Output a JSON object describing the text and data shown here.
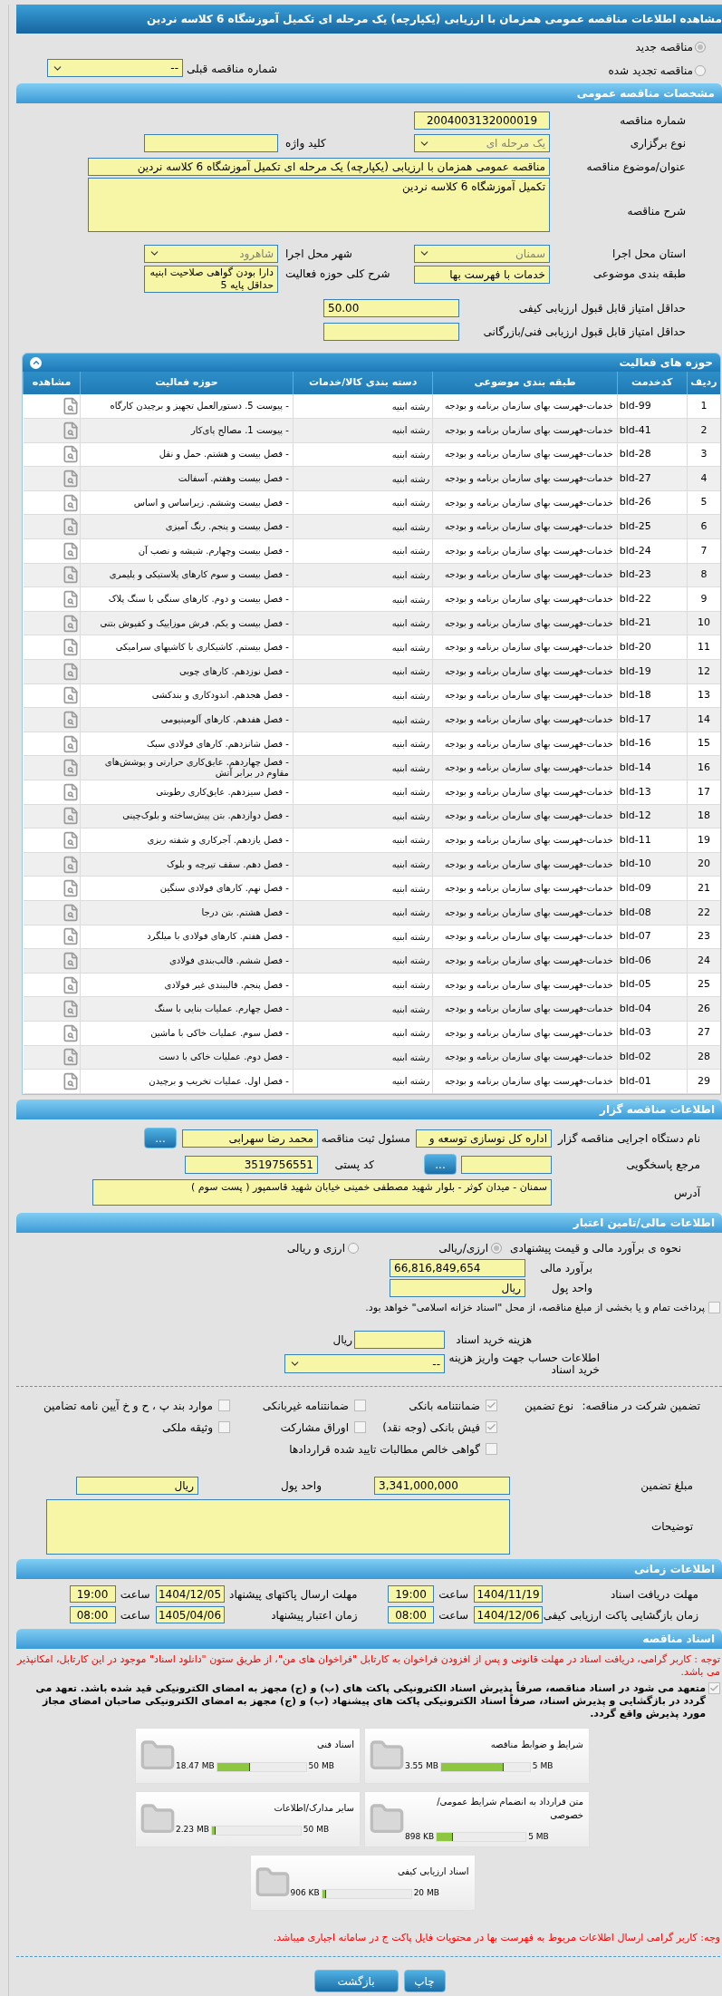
{
  "title": "مشاهده اطلاعات مناقصه عمومی همزمان با ارزیابی (یکپارچه) یک مرحله ای تکمیل آموزشگاه 6 کلاسه نردین",
  "tender_kind": [
    {
      "label": "مناقصه جدید",
      "selected": true
    },
    {
      "label": "مناقصه تجدید شده",
      "selected": false
    }
  ],
  "previous_tender": {
    "label": "شماره مناقصه قبلی",
    "value": "--"
  },
  "general": {
    "header": "مشخصات مناقصه عمومی",
    "tender_number": {
      "label": "شماره مناقصه",
      "value": "2004003132000019"
    },
    "holding_type": {
      "label": "نوع برگزاری",
      "value": "یک مرحله ای"
    },
    "keyword": {
      "label": "کلید واژه"
    },
    "subject": {
      "label": "عنوان/موضوع مناقصه",
      "value": "مناقصه عمومی همزمان با ارزیابی (یکپارچه) یک مرحله ای تکمیل آموزشگاه 6 کلاسه نردین"
    },
    "description": {
      "label": "شرح مناقصه",
      "value": "تکمیل آموزشگاه 6 کلاسه نردین"
    },
    "province": {
      "label": "استان محل اجرا",
      "value": "سمنان"
    },
    "city": {
      "label": "شهر محل اجرا",
      "value": "شاهرود"
    },
    "category": {
      "label": "طبقه بندی موضوعی",
      "value": "خدمات با فهرست بها"
    },
    "scope": {
      "label": "شرح کلی حوزه فعالیت",
      "value": "دارا بودن گواهی صلاحیت ابنیه حداقل پایه 5"
    },
    "min_quality": {
      "label": "حداقل امتیاز قابل قبول ارزیابی کیفی",
      "value": "50.00"
    },
    "min_technical": {
      "label": "حداقل امتیاز قابل قبول ارزیابی فنی/بازرگانی"
    }
  },
  "activities": {
    "header": "حوزه های فعالیت",
    "columns": [
      "ردیف",
      "کدخدمت",
      "طبقه بندی موضوعی",
      "دسته بندی کالا/خدمات",
      "حوزه فعالیت",
      "مشاهده"
    ],
    "rows": [
      {
        "row": "1",
        "code": "bld-99",
        "category": "خدمات-فهرست بهای سازمان برنامه و بودجه",
        "group": "رشته ابنیه",
        "activity": "- پیوست 5. دستورالعمل تجهیز و برچیدن کارگاه"
      },
      {
        "row": "2",
        "code": "bld-41",
        "category": "خدمات-فهرست بهای سازمان برنامه و بودجه",
        "group": "رشته ابنیه",
        "activity": "- پیوست 1. مصالح پای‌کار"
      },
      {
        "row": "3",
        "code": "bld-28",
        "category": "خدمات-فهرست بهای سازمان برنامه و بودجه",
        "group": "رشته ابنیه",
        "activity": "- فصل بیست و هشتم. حمل و نقل"
      },
      {
        "row": "4",
        "code": "bld-27",
        "category": "خدمات-فهرست بهای سازمان برنامه و بودجه",
        "group": "رشته ابنیه",
        "activity": "- فصل بیست وهفتم. آسفالت"
      },
      {
        "row": "5",
        "code": "bld-26",
        "category": "خدمات-فهرست بهای سازمان برنامه و بودجه",
        "group": "رشته ابنیه",
        "activity": "- فصل بیست وششم. زیراساس و اساس"
      },
      {
        "row": "6",
        "code": "bld-25",
        "category": "خدمات-فهرست بهای سازمان برنامه و بودجه",
        "group": "رشته ابنیه",
        "activity": "- فصل بیست و پنجم. رنگ آمیزی"
      },
      {
        "row": "7",
        "code": "bld-24",
        "category": "خدمات-فهرست بهای سازمان برنامه و بودجه",
        "group": "رشته ابنیه",
        "activity": "- فصل بیست وچهارم. شیشه و نصب آن"
      },
      {
        "row": "8",
        "code": "bld-23",
        "category": "خدمات-فهرست بهای سازمان برنامه و بودجه",
        "group": "رشته ابنیه",
        "activity": "- فصل بیست و سوم کارهای پلاستیکی و پلیمری"
      },
      {
        "row": "9",
        "code": "bld-22",
        "category": "خدمات-فهرست بهای سازمان برنامه و بودجه",
        "group": "رشته ابنیه",
        "activity": "- فصل بیست و دوم. کارهای سنگی با سنگ پلاک"
      },
      {
        "row": "10",
        "code": "bld-21",
        "category": "خدمات-فهرست بهای سازمان برنامه و بودجه",
        "group": "رشته ابنیه",
        "activity": "- فصل بیست و یکم. فرش موزاییک و کفپوش بتنی"
      },
      {
        "row": "11",
        "code": "bld-20",
        "category": "خدمات-فهرست بهای سازمان برنامه و بودجه",
        "group": "رشته ابنیه",
        "activity": "- فصل بیستم. کاشیکاری با کاشیهای سرامیکی"
      },
      {
        "row": "12",
        "code": "bld-19",
        "category": "خدمات-فهرست بهای سازمان برنامه و بودجه",
        "group": "رشته ابنیه",
        "activity": "- فصل نوزدهم. کارهای چوبی"
      },
      {
        "row": "13",
        "code": "bld-18",
        "category": "خدمات-فهرست بهای سازمان برنامه و بودجه",
        "group": "رشته ابنیه",
        "activity": "- فصل هجدهم. اندودکاری و بندکشی"
      },
      {
        "row": "14",
        "code": "bld-17",
        "category": "خدمات-فهرست بهای سازمان برنامه و بودجه",
        "group": "رشته ابنیه",
        "activity": "- فصل هفدهم. کارهای آلومینیومی"
      },
      {
        "row": "15",
        "code": "bld-16",
        "category": "خدمات-فهرست بهای سازمان برنامه و بودجه",
        "group": "رشته ابنیه",
        "activity": "- فصل شانزدهم. کارهای فولادی سبک"
      },
      {
        "row": "16",
        "code": "bld-14",
        "category": "خدمات-فهرست بهای سازمان برنامه و بودجه",
        "group": "رشته ابنیه",
        "activity": "- فصل چهاردهم. عایق‌کاری حرارتی و پوشش‌های مقاوم در برابر آتش"
      },
      {
        "row": "17",
        "code": "bld-13",
        "category": "خدمات-فهرست بهای سازمان برنامه و بودجه",
        "group": "رشته ابنیه",
        "activity": "- فصل سیزدهم. عایق‌کاری رطوبتی"
      },
      {
        "row": "18",
        "code": "bld-12",
        "category": "خدمات-فهرست بهای سازمان برنامه و بودجه",
        "group": "رشته ابنیه",
        "activity": "- فصل دوازدهم. بتن پیش‌ساخته و بلوک‌چینی"
      },
      {
        "row": "19",
        "code": "bld-11",
        "category": "خدمات-فهرست بهای سازمان برنامه و بودجه",
        "group": "رشته ابنیه",
        "activity": "- فصل یازدهم. آجرکاری و شفته ریزی"
      },
      {
        "row": "20",
        "code": "bld-10",
        "category": "خدمات-فهرست بهای سازمان برنامه و بودجه",
        "group": "رشته ابنیه",
        "activity": "- فصل دهم. سقف تیرچه و بلوک"
      },
      {
        "row": "21",
        "code": "bld-09",
        "category": "خدمات-فهرست بهای سازمان برنامه و بودجه",
        "group": "رشته ابنیه",
        "activity": "- فصل نهم. کارهای فولادی سنگین"
      },
      {
        "row": "22",
        "code": "bld-08",
        "category": "خدمات-فهرست بهای سازمان برنامه و بودجه",
        "group": "رشته ابنیه",
        "activity": "- فصل هشتم. بتن درجا"
      },
      {
        "row": "23",
        "code": "bld-07",
        "category": "خدمات-فهرست بهای سازمان برنامه و بودجه",
        "group": "رشته ابنیه",
        "activity": "- فصل هفتم. کارهای فولادی با میلگرد"
      },
      {
        "row": "24",
        "code": "bld-06",
        "category": "خدمات-فهرست بهای سازمان برنامه و بودجه",
        "group": "رشته ابنیه",
        "activity": "- فصل ششم. قالب‌بندی فولادی"
      },
      {
        "row": "25",
        "code": "bld-05",
        "category": "خدمات-فهرست بهای سازمان برنامه و بودجه",
        "group": "رشته ابنیه",
        "activity": "- فصل پنجم. قالببندی غیر فولادی"
      },
      {
        "row": "26",
        "code": "bld-04",
        "category": "خدمات-فهرست بهای سازمان برنامه و بودجه",
        "group": "رشته ابنیه",
        "activity": "- فصل چهارم. عملیات بنایی با سنگ"
      },
      {
        "row": "27",
        "code": "bld-03",
        "category": "خدمات-فهرست بهای سازمان برنامه و بودجه",
        "group": "رشته ابنیه",
        "activity": "- فصل سوم. عملیات خاکی با ماشین"
      },
      {
        "row": "28",
        "code": "bld-02",
        "category": "خدمات-فهرست بهای سازمان برنامه و بودجه",
        "group": "رشته ابنیه",
        "activity": "- فصل دوم. عملیات خاکی با دست"
      },
      {
        "row": "29",
        "code": "bld-01",
        "category": "خدمات-فهرست بهای سازمان برنامه و بودجه",
        "group": "رشته ابنیه",
        "activity": "- فصل اول. عملیات تخریب و برچیدن"
      }
    ]
  },
  "contractor": {
    "header": "اطلاعات مناقصه گزار",
    "organization": {
      "label": "نام دستگاه اجرایی مناقصه گزار",
      "value": "اداره کل نوسازی  توسعه و"
    },
    "registrar": {
      "label": "مسئول ثبت مناقصه",
      "value": "محمد رضا  سهرابی",
      "button": "..."
    },
    "reference": {
      "label": "مرجع پاسخگویی",
      "button": "..."
    },
    "postal_code": {
      "label": "کد پستی",
      "value": "3519756551"
    },
    "address": {
      "label": "آدرس",
      "value": "سمنان - میدان کوثر - بلوار شهید مصطفی خمینی خیابان شهید قاسمپور ( پست سوم )"
    }
  },
  "financial": {
    "header": "اطلاعات مالی/تامین اعتبار",
    "estimate_method": {
      "label": "نحوه ی برآورد مالی و قیمت پیشنهادی",
      "options": [
        {
          "label": "ارزی/ریالی",
          "selected": true
        },
        {
          "label": "ارزی و ریالی",
          "selected": false
        }
      ]
    },
    "estimate": {
      "label": "برآورد مالی",
      "value": "66,816,849,654"
    },
    "currency": {
      "label": "واحد پول",
      "value": "ریال"
    },
    "treasury": {
      "label": "پرداخت تمام و یا بخشی از مبلغ مناقصه، از محل \"اسناد خزانه اسلامی\" خواهد بود.",
      "checked": false
    },
    "document_fee": {
      "label": "هزینه خرید اسناد",
      "unit": "ریال"
    },
    "account": {
      "label": "اطلاعات حساب جهت واریز هزینه خرید اسناد",
      "value": "--"
    },
    "guarantee": {
      "label": "تضمین شرکت در مناقصه:",
      "type_label": "نوع تضمین",
      "options": [
        {
          "label": "ضمانتنامه بانکی",
          "checked": true
        },
        {
          "label": "ضمانتنامه غیربانکی",
          "checked": false
        },
        {
          "label": "موارد بند پ ، ح و خ آیین نامه تضامین",
          "checked": false
        },
        {
          "label": "فیش بانکی (وجه نقد)",
          "checked": true
        },
        {
          "label": "اوراق مشارکت",
          "checked": false
        },
        {
          "label": "وثیقه ملکی",
          "checked": false
        },
        {
          "label": "گواهی خالص مطالبات تایید شده قراردادها",
          "checked": false
        }
      ]
    },
    "guarantee_amount": {
      "label": "مبلغ تضمین",
      "value": "3,341,000,000"
    },
    "guarantee_currency": {
      "label": "واحد پول",
      "value": "ریال"
    },
    "notes": {
      "label": "توضیحات"
    }
  },
  "timing": {
    "header": "اطلاعات زمانی",
    "items": [
      {
        "label": "مهلت دریافت اسناد",
        "date": "1404/11/19",
        "time_label": "ساعت",
        "time": "19:00"
      },
      {
        "label": "مهلت ارسال پاکتهای پیشنهاد",
        "date": "1404/12/05",
        "time_label": "ساعت",
        "time": "19:00"
      },
      {
        "label": "زمان بازگشایی پاکت ارزیابی کیفی",
        "date": "1404/12/06",
        "time_label": "ساعت",
        "time": "08:00"
      },
      {
        "label": "زمان اعتبار پیشنهاد",
        "date": "1405/04/06",
        "time_label": "ساعت",
        "time": "08:00"
      }
    ]
  },
  "documents": {
    "header": "اسناد مناقصه",
    "notice": "توجه : کاربر گرامی، دریافت اسناد در مهلت قانونی و پس از افزودن فراخوان به کارتابل \"فراخوان های من\"، از طریق ستون \"دانلود اسناد\" موجود در این کارتابل، امکانپذیر می باشد.",
    "commitment": {
      "text": "متعهد می شود در اسناد مناقصه، صرفاً پذیرش اسناد الکترونیکی پاکت های (ب) و (ج) مجهز به امضای الکترونیکی قید شده باشد. تعهد می گردد در بازگشایی و پذیرش اسناد، صرفاً اسناد الکترونیکی پاکت های پیشنهاد (ب) و (ج) مجهز به امضای الکترونیکی صاحبان امضای مجاز مورد پذیرش واقع گردد.",
      "checked": true
    },
    "files": [
      {
        "name": "شرایط و ضوابط مناقصه",
        "size": "3.55 MB",
        "limit": "5 MB",
        "level": 0.71
      },
      {
        "name": "اسناد فنی",
        "size": "18.47 MB",
        "limit": "50 MB",
        "level": 0.37
      },
      {
        "name": "متن قرارداد به انضمام شرایط عمومی/خصوصی",
        "size": "898 KB",
        "limit": "5 MB",
        "level": 0.18
      },
      {
        "name": "سایر مدارک/اطلاعات",
        "size": "2.23 MB",
        "limit": "50 MB",
        "level": 0.045
      },
      {
        "name": "اسناد ارزیابی کیفی",
        "size": "906 KB",
        "limit": "20 MB",
        "level": 0.044
      }
    ],
    "final_note": "وجه: کاربر گرامی ارسال اطلاعات مربوط به فهرست بها در محتویات فایل پاکت ج در سامانه اجباری میباشد."
  },
  "buttons": [
    "چاپ",
    "بازگشت"
  ]
}
